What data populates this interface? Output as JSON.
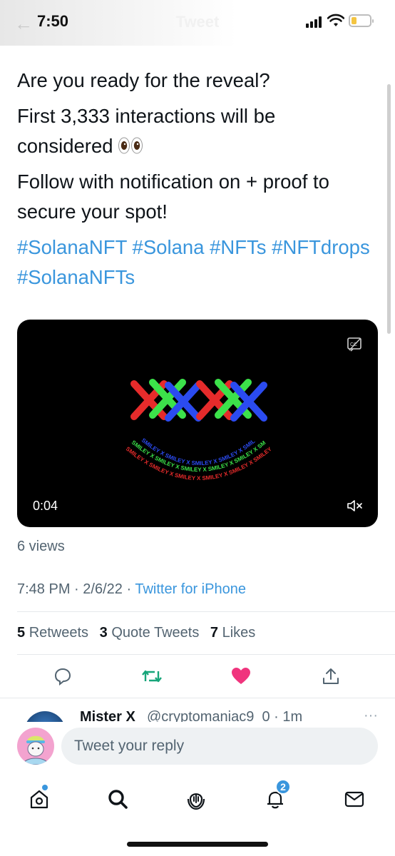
{
  "status_bar": {
    "time": "7:50",
    "nav_title": "Tweet"
  },
  "tweet": {
    "line1": "Are you ready for the reveal?",
    "line2": "First 3,333 interactions will be considered",
    "line3": "Follow with notification on + proof to secure your spot!",
    "hashtags": "#SolanaNFT #Solana #NFTs #NFTdrops #SolanaNFTs"
  },
  "video": {
    "timestamp": "0:04",
    "art_text": "SMILEY X SMILEY X SMILEY X SMILEY X SMILEY X SMILEY X"
  },
  "views": "6 views",
  "meta": {
    "time": "7:48 PM",
    "date": "2/6/22",
    "source": "Twitter for iPhone",
    "separator": "·"
  },
  "stats": {
    "retweets_count": "5",
    "retweets_label": "Retweets",
    "quotes_count": "3",
    "quotes_label": "Quote Tweets",
    "likes_count": "7",
    "likes_label": "Likes"
  },
  "next_reply": {
    "name": "Mister X",
    "handle": "@cryptomaniac9_0 · 1m",
    "more": "···"
  },
  "reply_bar": {
    "placeholder": "Tweet your reply"
  },
  "tab_bar": {
    "notifications_badge": "2"
  },
  "colors": {
    "accent": "#3a96dd",
    "like": "#f0347d",
    "retweet": "#17a57a"
  }
}
